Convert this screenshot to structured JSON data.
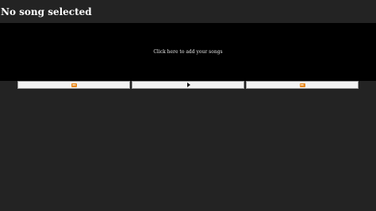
{
  "player": {
    "title": "No song selected"
  },
  "playlist": {
    "add_prompt": "Click here to add your songs"
  },
  "controls": {
    "icons": [
      "previous-icon",
      "play-icon",
      "next-icon"
    ],
    "accent_color": "#e88a1f",
    "button_bg": "#f2f2f2"
  },
  "colors": {
    "page_bg": "#232323",
    "drop_zone_bg": "#000000"
  }
}
